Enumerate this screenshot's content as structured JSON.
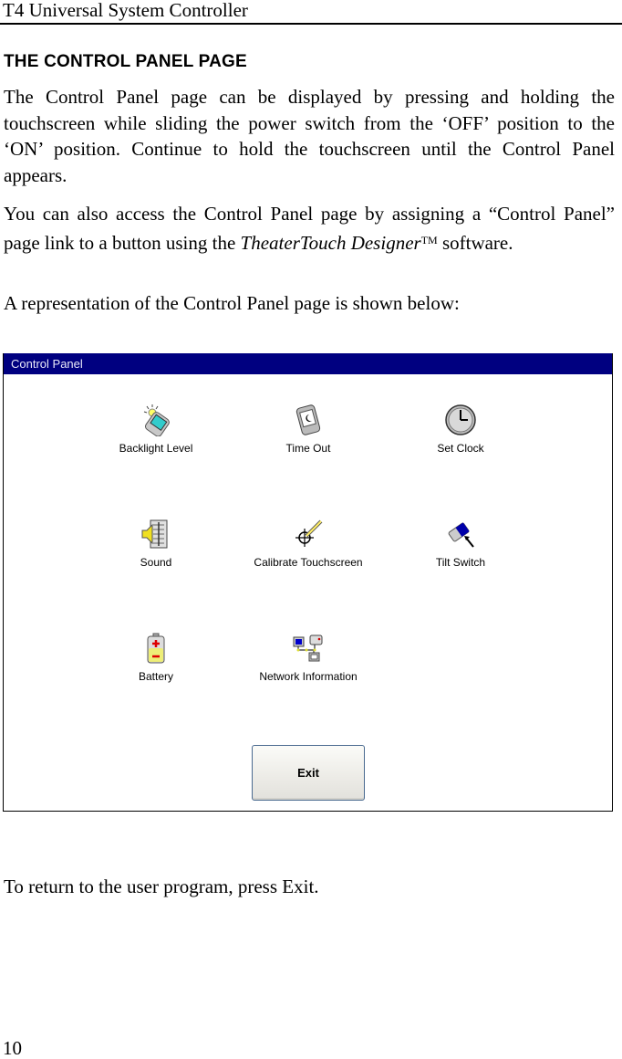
{
  "header": {
    "running_title": "T4 Universal System Controller"
  },
  "section": {
    "title": "THE CONTROL PANEL PAGE"
  },
  "paragraphs": {
    "p1": "The Control Panel page can be displayed by pressing and holding the touchscreen while sliding the power switch from the ‘OFF’ position to the ‘ON’ position. Continue to hold the touchscreen until the Control Panel appears.",
    "p2_before": "You can also access the Control Panel page by assigning a “Control Panel” page link to a button using the ",
    "p2_italic": "TheaterTouch Designer",
    "p2_tm": "TM",
    "p2_after": " software.",
    "p3": "A representation of the Control Panel page is shown below:",
    "p4": "To return to the user program, press Exit."
  },
  "control_panel": {
    "title": "Control Panel",
    "title_bar_color": "#000080",
    "items": [
      {
        "label": "Backlight Level",
        "icon": "backlight-icon"
      },
      {
        "label": "Time Out",
        "icon": "timeout-icon"
      },
      {
        "label": "Set Clock",
        "icon": "clock-icon"
      },
      {
        "label": "Sound",
        "icon": "sound-icon"
      },
      {
        "label": "Calibrate Touchscreen",
        "icon": "calibrate-icon"
      },
      {
        "label": "Tilt Switch",
        "icon": "tilt-switch-icon"
      },
      {
        "label": "Battery",
        "icon": "battery-icon"
      },
      {
        "label": "Network Information",
        "icon": "network-icon"
      }
    ],
    "exit_label": "Exit"
  },
  "footer": {
    "page_number": "10"
  }
}
